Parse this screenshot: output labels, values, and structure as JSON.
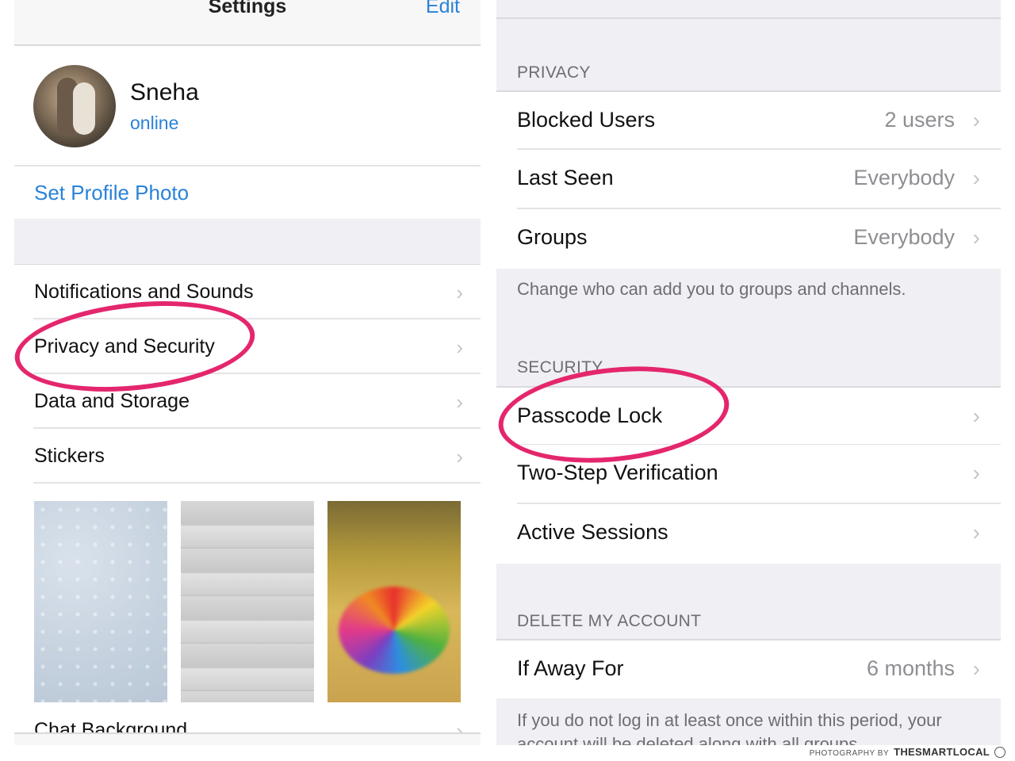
{
  "left": {
    "nav": {
      "title": "Settings",
      "edit_label": "Edit"
    },
    "profile": {
      "name": "Sneha",
      "status": "online"
    },
    "set_profile_photo": "Set Profile Photo",
    "menu": [
      {
        "label": "Notifications and Sounds"
      },
      {
        "label": "Privacy and Security"
      },
      {
        "label": "Data and Storage"
      },
      {
        "label": "Stickers"
      }
    ],
    "chat_background_label": "Chat Background"
  },
  "right": {
    "privacy": {
      "header": "PRIVACY",
      "rows": [
        {
          "label": "Blocked Users",
          "value": "2 users"
        },
        {
          "label": "Last Seen",
          "value": "Everybody"
        },
        {
          "label": "Groups",
          "value": "Everybody"
        }
      ],
      "footer": "Change who can add you to groups and channels."
    },
    "security": {
      "header": "SECURITY",
      "rows": [
        {
          "label": "Passcode Lock"
        },
        {
          "label": "Two-Step Verification"
        },
        {
          "label": "Active Sessions"
        }
      ]
    },
    "delete_account": {
      "header": "DELETE MY ACCOUNT",
      "row": {
        "label": "If Away For",
        "value": "6 months"
      },
      "footer": "If you do not log in at least once within this period, your account will be deleted along with all groups"
    }
  },
  "icons": {
    "chevron": "chevron-right-icon"
  },
  "colors": {
    "accent_blue": "#2a82d8",
    "highlight_pink": "#e4266d",
    "secondary_text": "#8e8e93",
    "group_bg": "#efeff4"
  },
  "watermark": {
    "prefix": "PHOTOGRAPHY BY",
    "brand": "THESMARTLOCAL"
  }
}
